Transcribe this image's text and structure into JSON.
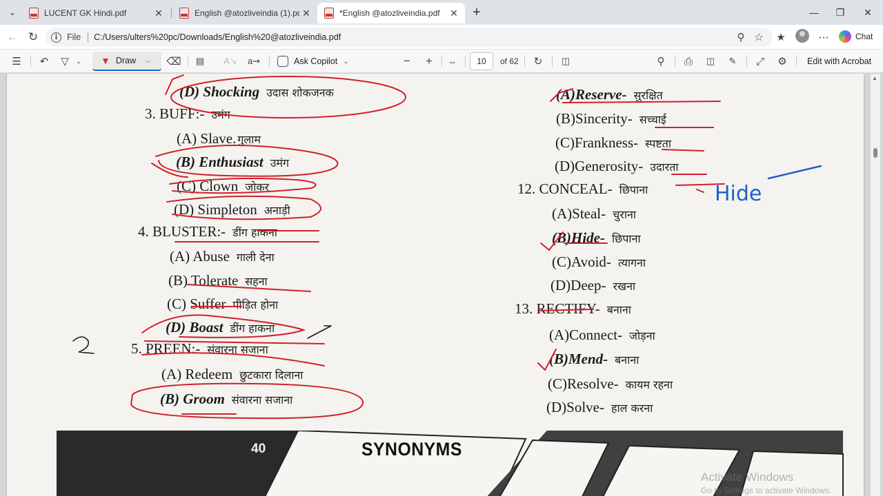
{
  "tabs": [
    {
      "title": "LUCENT GK Hindi.pdf",
      "active": false
    },
    {
      "title": "English @atozliveindia (1).pdf",
      "active": false
    },
    {
      "title": "*English @atozliveindia.pdf",
      "active": true
    }
  ],
  "address": {
    "scheme": "File",
    "path": "C:/Users/ulters%20pc/Downloads/English%20@atozliveindia.pdf"
  },
  "chat_label": "Chat",
  "toolbar": {
    "draw_label": "Draw",
    "ask_copilot_label": "Ask Copilot",
    "current_page": "10",
    "total_pages": "of 62",
    "edit_acrobat_label": "Edit with Acrobat",
    "icons": [
      "contents-icon",
      "undo-icon",
      "highlight-icon",
      "erase-icon",
      "text-box-icon",
      "read-aloud-icon",
      "ask-copilot-icon",
      "zoom-out-icon",
      "zoom-in-icon",
      "fit-page-icon",
      "rotate-icon",
      "page-view-icon",
      "search-icon",
      "print-icon",
      "save-icon",
      "save-as-icon",
      "fullscreen-icon",
      "settings-icon"
    ]
  },
  "document": {
    "left_column": [
      {
        "type": "option",
        "label": "(D) Shocking",
        "hindi": "उदास शोकजनक"
      },
      {
        "type": "question",
        "label": "3. BUFF:-",
        "hindi": "उमंग"
      },
      {
        "type": "option",
        "label": "(A) Slave.",
        "hindi": "गुलाम"
      },
      {
        "type": "option",
        "label": "(B) Enthusiast",
        "hindi": "उमंग"
      },
      {
        "type": "option",
        "label": "(C) Clown",
        "hindi": "जोकर"
      },
      {
        "type": "option",
        "label": "(D) Simpleton",
        "hindi": "अनाड़ी"
      },
      {
        "type": "question",
        "label": "4. BLUSTER:-",
        "hindi": "डींग हाकना"
      },
      {
        "type": "option",
        "label": "(A) Abuse",
        "hindi": "गाली देना"
      },
      {
        "type": "option",
        "label": "(B) Tolerate",
        "hindi": "सहना"
      },
      {
        "type": "option",
        "label": "(C) Suffer",
        "hindi": "पीड़ित होना"
      },
      {
        "type": "option",
        "label": "(D) Boast",
        "hindi": "डींग हाकना"
      },
      {
        "type": "question",
        "label": "5. PREEN:-",
        "hindi": "संवारना सजाना"
      },
      {
        "type": "option",
        "label": "(A) Redeem",
        "hindi": "छुटकारा दिलाना"
      },
      {
        "type": "option",
        "label": "(B) Groom",
        "hindi": "संवारना सजाना"
      }
    ],
    "right_column": [
      {
        "type": "option",
        "label": "(A)Reserve-",
        "hindi": "सुरक्षित"
      },
      {
        "type": "option",
        "label": "(B)Sincerity-",
        "hindi": "सच्चाई"
      },
      {
        "type": "option",
        "label": "(C)Frankness-",
        "hindi": "स्पष्टता"
      },
      {
        "type": "option",
        "label": "(D)Generosity-",
        "hindi": "उदारता"
      },
      {
        "type": "question",
        "label": "12. CONCEAL-",
        "hindi": "छिपाना"
      },
      {
        "type": "option",
        "label": "(A)Steal-",
        "hindi": "चुराना"
      },
      {
        "type": "option",
        "label": "(B)Hide-",
        "hindi": "छिपाना"
      },
      {
        "type": "option",
        "label": "(C)Avoid-",
        "hindi": "त्यागना"
      },
      {
        "type": "option",
        "label": "(D)Deep-",
        "hindi": "रखना"
      },
      {
        "type": "question",
        "label": "13. RECTIFY-",
        "hindi": "बनाना"
      },
      {
        "type": "option",
        "label": "(A)Connect-",
        "hindi": "जोड़ना"
      },
      {
        "type": "option",
        "label": "(B)Mend-",
        "hindi": "बनाना"
      },
      {
        "type": "option",
        "label": "(C)Resolve-",
        "hindi": "कायम रहना"
      },
      {
        "type": "option",
        "label": "(D)Solve-",
        "hindi": "हाल करना"
      }
    ],
    "handwritten_note": "Hide",
    "footer": {
      "page_number": "40",
      "section": "SYNONYMS"
    }
  },
  "watermark": {
    "line1": "Activate Windows",
    "line2": "Go to Settings to activate Windows."
  },
  "colors": {
    "annotation_red": "#d21f2a",
    "annotation_blue": "#1f5fc8",
    "tab_bar": "#dfe3e8",
    "footer_dark": "#2a2a2a"
  }
}
